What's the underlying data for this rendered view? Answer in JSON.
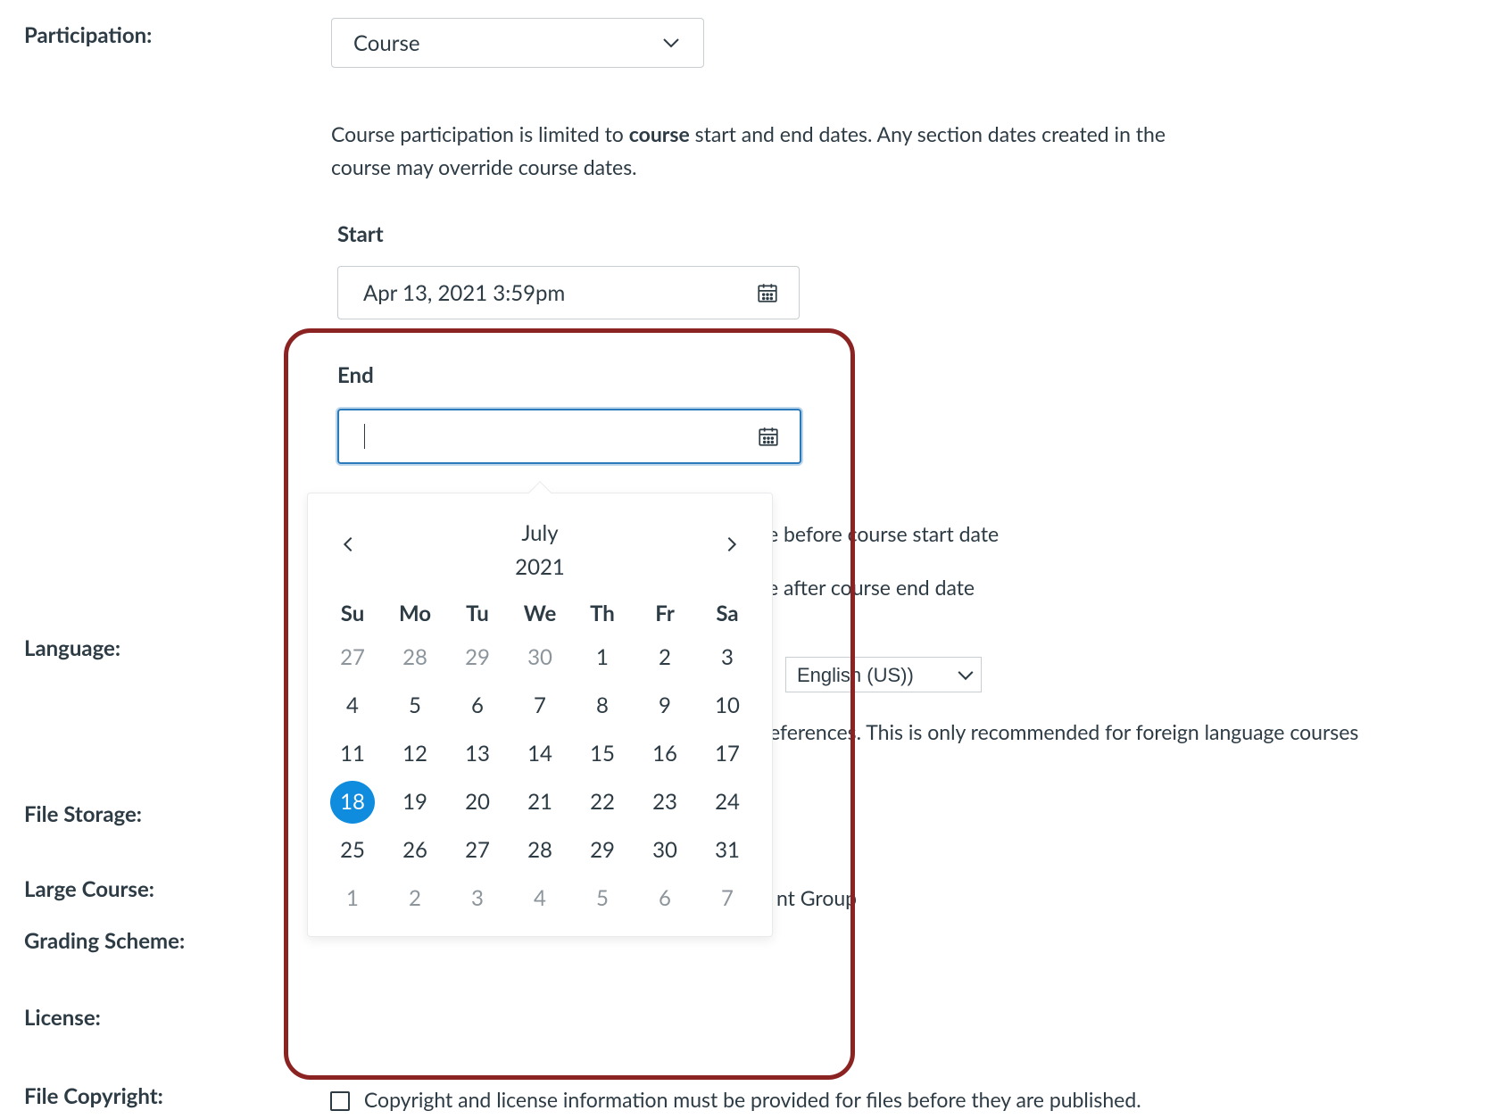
{
  "participation": {
    "label": "Participation:",
    "value": "Course",
    "helper_pre": "Course participation is limited to ",
    "helper_bold": "course",
    "helper_post": " start and end dates. Any section dates created in the course may override course dates.",
    "start": {
      "label": "Start",
      "value": "Apr 13, 2021 3:59pm"
    },
    "end": {
      "label": "End",
      "value": ""
    },
    "restrict_before_fragment": "e before course start date",
    "restrict_after_fragment": "e after course end date"
  },
  "language": {
    "label": "Language:",
    "value": "English (US))",
    "helper_fragment": "eferences. This is only recommended for foreign language courses"
  },
  "file_storage": {
    "label": "File Storage:"
  },
  "large_course": {
    "label": "Large Course:",
    "helper_fragment": "nt Group"
  },
  "grading_scheme": {
    "label": "Grading Scheme:"
  },
  "license": {
    "label": "License:"
  },
  "file_copyright": {
    "label": "File Copyright:",
    "text": "Copyright and license information must be provided for files before they are published."
  },
  "calendar": {
    "month": "July",
    "year": "2021",
    "dow": [
      "Su",
      "Mo",
      "Tu",
      "We",
      "Th",
      "Fr",
      "Sa"
    ],
    "today": 18,
    "weeks": [
      [
        {
          "n": 27,
          "m": true
        },
        {
          "n": 28,
          "m": true
        },
        {
          "n": 29,
          "m": true
        },
        {
          "n": 30,
          "m": true
        },
        {
          "n": 1
        },
        {
          "n": 2
        },
        {
          "n": 3
        }
      ],
      [
        {
          "n": 4
        },
        {
          "n": 5
        },
        {
          "n": 6
        },
        {
          "n": 7
        },
        {
          "n": 8
        },
        {
          "n": 9
        },
        {
          "n": 10
        }
      ],
      [
        {
          "n": 11
        },
        {
          "n": 12
        },
        {
          "n": 13
        },
        {
          "n": 14
        },
        {
          "n": 15
        },
        {
          "n": 16
        },
        {
          "n": 17
        }
      ],
      [
        {
          "n": 18
        },
        {
          "n": 19
        },
        {
          "n": 20
        },
        {
          "n": 21
        },
        {
          "n": 22
        },
        {
          "n": 23
        },
        {
          "n": 24
        }
      ],
      [
        {
          "n": 25
        },
        {
          "n": 26
        },
        {
          "n": 27
        },
        {
          "n": 28
        },
        {
          "n": 29
        },
        {
          "n": 30
        },
        {
          "n": 31
        }
      ],
      [
        {
          "n": 1,
          "m": true
        },
        {
          "n": 2,
          "m": true
        },
        {
          "n": 3,
          "m": true
        },
        {
          "n": 4,
          "m": true
        },
        {
          "n": 5,
          "m": true
        },
        {
          "n": 6,
          "m": true
        },
        {
          "n": 7,
          "m": true
        }
      ]
    ]
  }
}
